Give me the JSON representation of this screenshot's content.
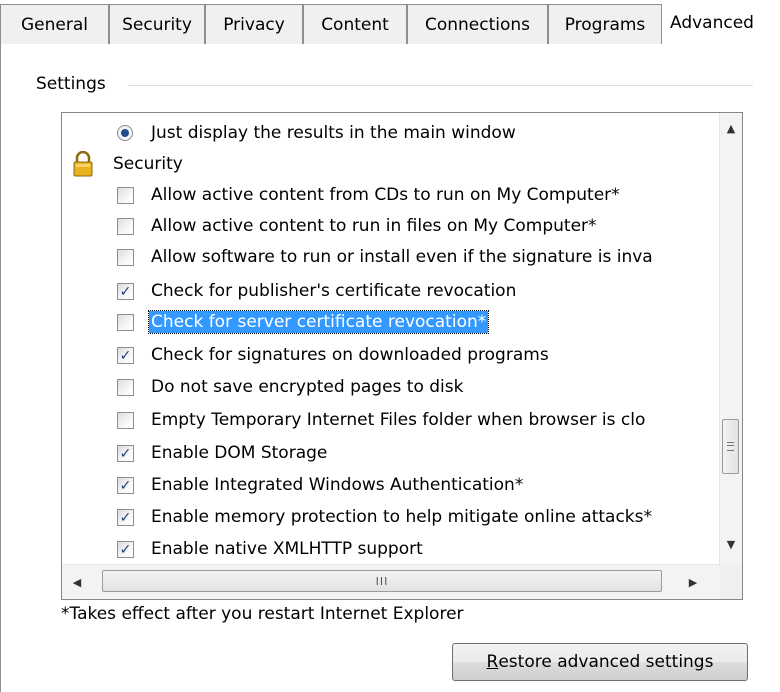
{
  "tabs": [
    {
      "label": "General",
      "active": false
    },
    {
      "label": "Security",
      "active": false
    },
    {
      "label": "Privacy",
      "active": false
    },
    {
      "label": "Content",
      "active": false
    },
    {
      "label": "Connections",
      "active": false
    },
    {
      "label": "Programs",
      "active": false
    },
    {
      "label": "Advanced",
      "active": true
    }
  ],
  "settings": {
    "group_label": "Settings",
    "list": {
      "radio_item": {
        "label": "Just display the results in the main window",
        "selected": true
      },
      "category": {
        "label": "Security",
        "icon": "lock-icon"
      },
      "items": [
        {
          "label": "Allow active content from CDs to run on My Computer*",
          "checked": false
        },
        {
          "label": "Allow active content to run in files on My Computer*",
          "checked": false
        },
        {
          "label": "Allow software to run or install even if the signature is inva",
          "checked": false
        },
        {
          "label": "Check for publisher's certificate revocation",
          "checked": true
        },
        {
          "label": "Check for server certificate revocation*",
          "checked": false,
          "selected": true
        },
        {
          "label": "Check for signatures on downloaded programs",
          "checked": true
        },
        {
          "label": "Do not save encrypted pages to disk",
          "checked": false
        },
        {
          "label": "Empty Temporary Internet Files folder when browser is clo",
          "checked": false
        },
        {
          "label": "Enable DOM Storage",
          "checked": true
        },
        {
          "label": "Enable Integrated Windows Authentication*",
          "checked": true
        },
        {
          "label": "Enable memory protection to help mitigate online attacks*",
          "checked": true
        },
        {
          "label": "Enable native XMLHTTP support",
          "checked": true
        }
      ]
    },
    "hscroll_grip": "III"
  },
  "footnote": "*Takes effect after you restart Internet Explorer",
  "restore_button": {
    "accel": "R",
    "rest": "estore advanced settings"
  },
  "colors": {
    "selection": "#3399ff",
    "check": "#1c3f78",
    "lock": "#d4a017"
  }
}
